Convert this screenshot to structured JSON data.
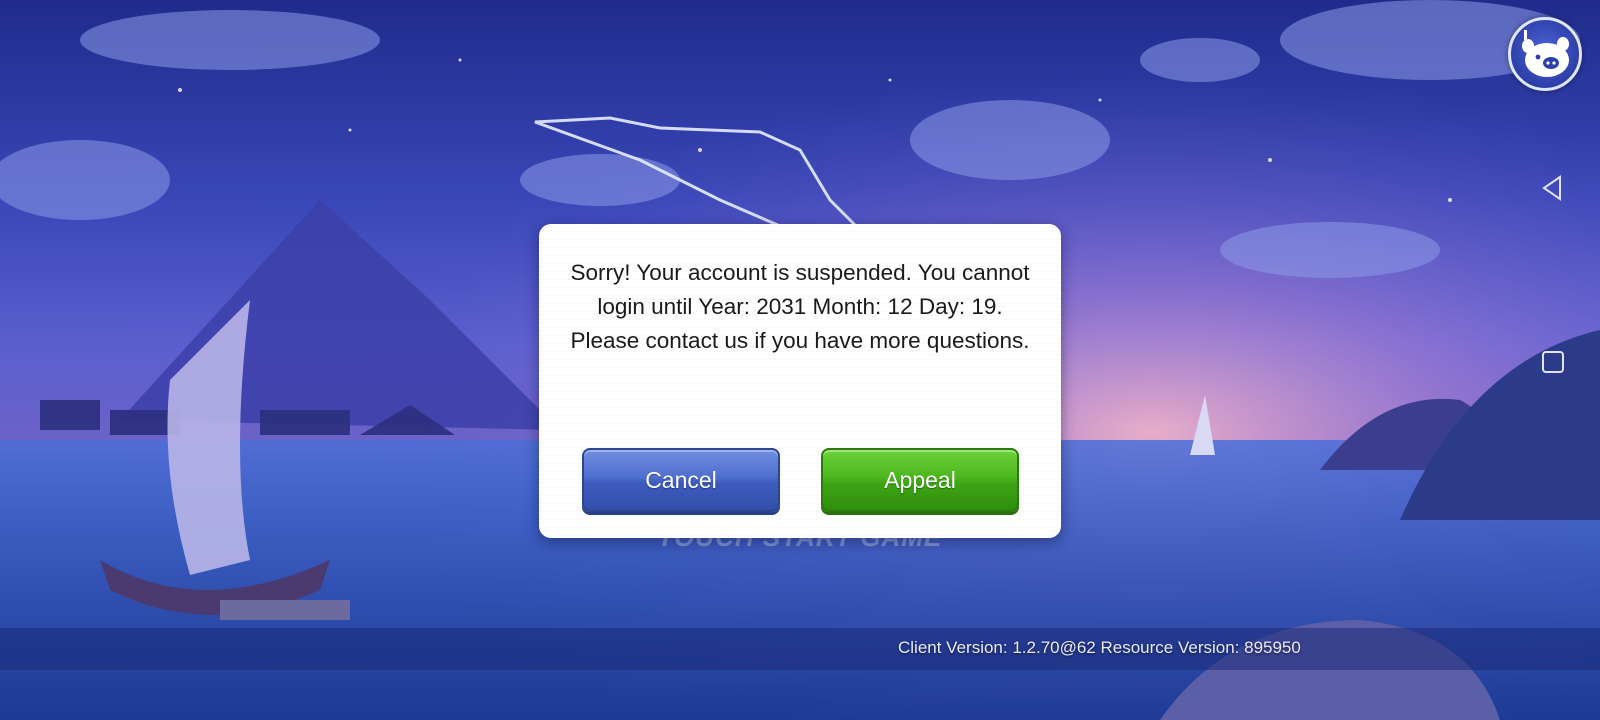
{
  "dialog": {
    "message": "Sorry! Your account is suspended. You cannot login until Year: 2031 Month: 12 Day: 19. Please contact us if you have more questions.",
    "cancel_label": "Cancel",
    "appeal_label": "Appeal"
  },
  "background": {
    "touch_start_label": "TOUCH START GAME"
  },
  "footer": {
    "version_text": "Client Version: 1.2.70@62 Resource Version: 895950"
  },
  "icons": {
    "help": "pig-help-icon",
    "back": "back-triangle-icon",
    "home": "home-square-icon"
  },
  "colors": {
    "cancel": "#4f6fcf",
    "appeal": "#4cb81d"
  }
}
